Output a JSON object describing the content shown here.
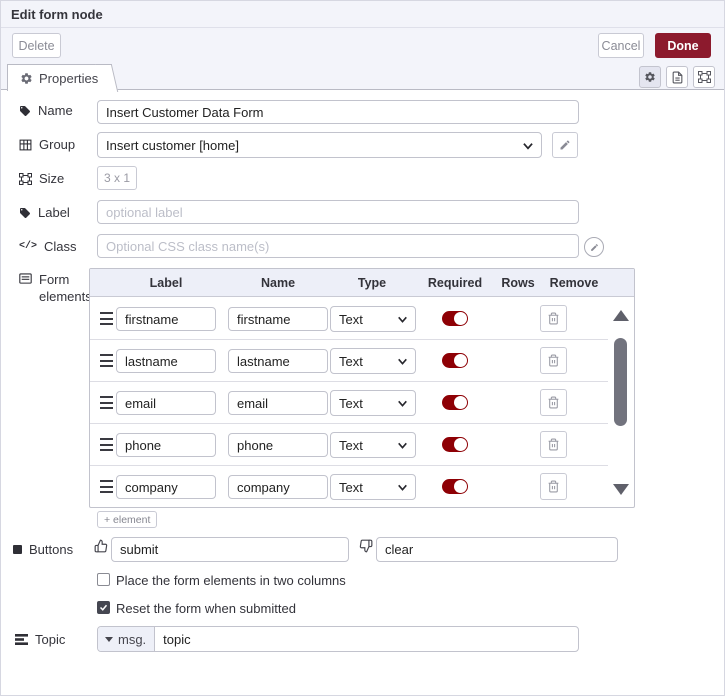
{
  "colors": {
    "accent_red": "#8c1a2d",
    "toggle_on": "#8e0005",
    "panel_bg": "#f3f4fa"
  },
  "dialog": {
    "title": "Edit form node",
    "delete_label": "Delete",
    "cancel_label": "Cancel",
    "done_label": "Done"
  },
  "tabs": {
    "properties_label": "Properties"
  },
  "fields": {
    "name": {
      "label": "Name",
      "value": "Insert Customer Data Form"
    },
    "group": {
      "label": "Group",
      "value": "Insert customer [home]"
    },
    "size": {
      "label": "Size",
      "value": "3 x 1"
    },
    "label": {
      "label": "Label",
      "placeholder": "optional label"
    },
    "css": {
      "label": "Class",
      "icon_text": "</>",
      "placeholder": "Optional CSS class name(s)"
    },
    "form_elements": {
      "label": "Form elements",
      "columns": [
        "Label",
        "Name",
        "Type",
        "Required",
        "Rows",
        "Remove"
      ],
      "rows": [
        {
          "label": "firstname",
          "name": "firstname",
          "type": "Text",
          "required": true
        },
        {
          "label": "lastname",
          "name": "lastname",
          "type": "Text",
          "required": true
        },
        {
          "label": "email",
          "name": "email",
          "type": "Text",
          "required": true
        },
        {
          "label": "phone",
          "name": "phone",
          "type": "Text",
          "required": true
        },
        {
          "label": "company",
          "name": "company",
          "type": "Text",
          "required": true
        }
      ],
      "add_label": "+ element"
    },
    "buttons": {
      "label": "Buttons",
      "submit_value": "submit",
      "clear_value": "clear"
    },
    "options": [
      {
        "label": "Place the form elements in two columns",
        "checked": false
      },
      {
        "label": "Reset the form when submitted",
        "checked": true
      }
    ],
    "topic": {
      "label": "Topic",
      "type_prefix": "msg.",
      "value": "topic"
    }
  }
}
